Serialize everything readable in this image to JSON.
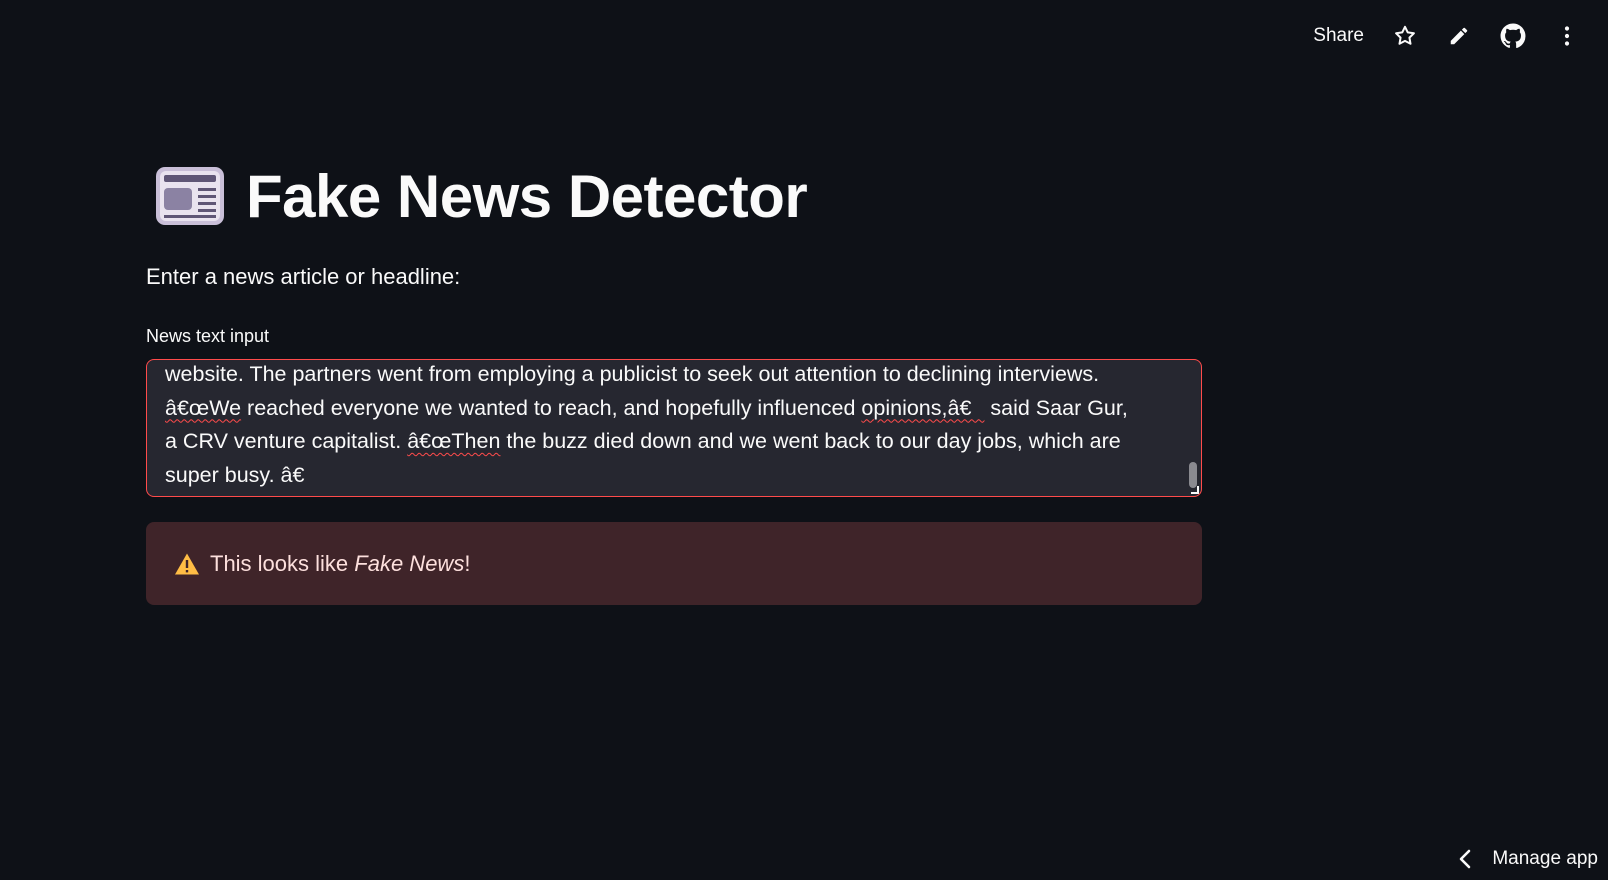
{
  "toolbar": {
    "share_label": "Share",
    "icons": [
      "star-icon",
      "pencil-icon",
      "github-icon",
      "more-vertical-icon"
    ]
  },
  "header": {
    "icon": "newspaper-icon",
    "title": "Fake News Detector"
  },
  "form": {
    "prompt": "Enter a news article or headline:",
    "input_label": "News text input",
    "input_value_lines": [
      "website. The partners went from employing a publicist to seek out attention to declining interviews.",
      "â€œWe reached everyone we wanted to reach, and hopefully influenced opinions,â€ said Saar Gur,",
      "a CRV venture capitalist. â€œThen the buzz died down and we went back to our day jobs, which are",
      "super busy. â€"
    ]
  },
  "result": {
    "icon": "warning-icon",
    "text_prefix": "This looks like ",
    "text_emphasis": "Fake News",
    "text_suffix": "!"
  },
  "footer": {
    "manage_label": "Manage app",
    "icon": "chevron-left-icon"
  },
  "colors": {
    "background": "#0e1117",
    "input_background": "#262730",
    "input_border_error": "#ff4b4b",
    "alert_background": "#3f2429",
    "alert_text": "#fde0dd",
    "warning_icon": "#ffbd45"
  }
}
